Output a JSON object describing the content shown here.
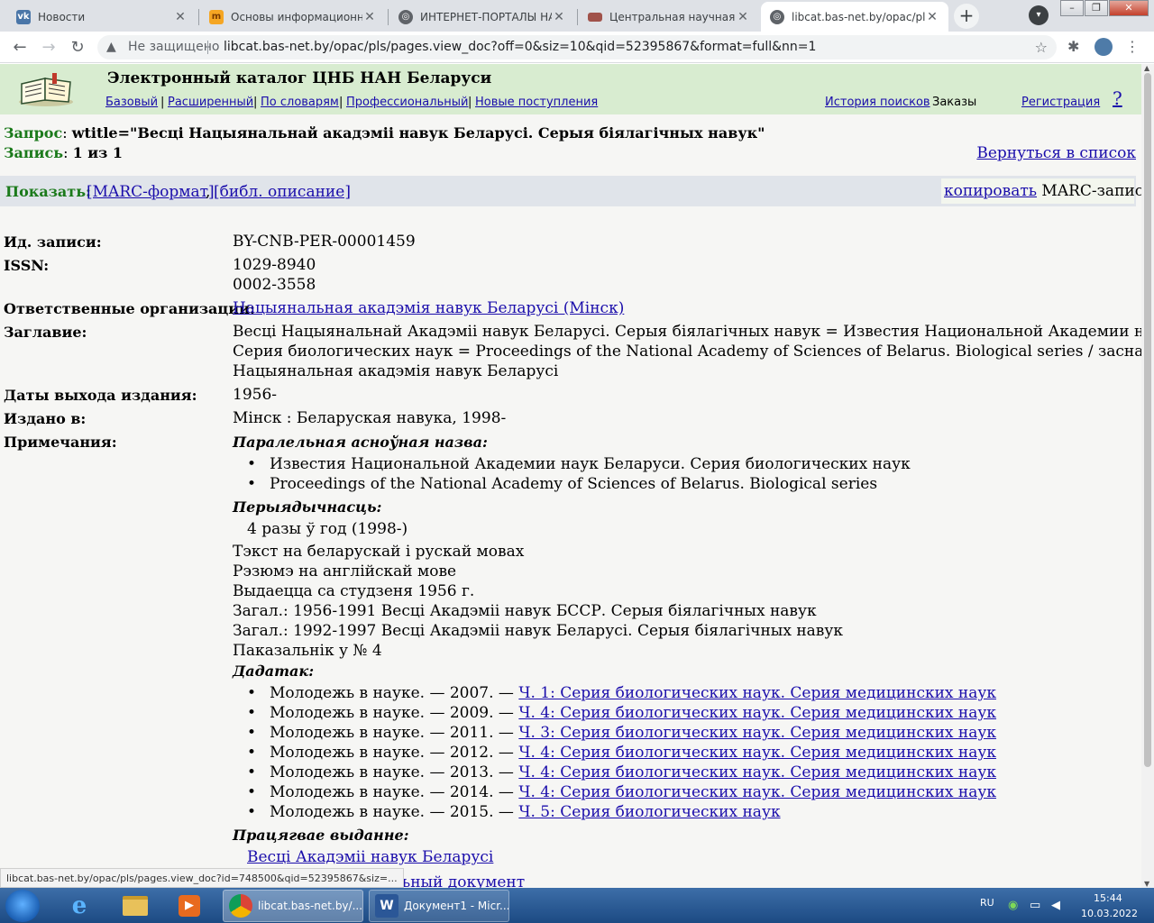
{
  "browser": {
    "tabs": [
      {
        "title": "Новости",
        "icon": "vk-icon"
      },
      {
        "title": "Основы информационной",
        "icon": "tm-icon"
      },
      {
        "title": "ИНТЕРНЕТ-ПОРТАЛЫ НАУ",
        "icon": "globe-icon"
      },
      {
        "title": "Центральная научная биб",
        "icon": "library-icon"
      },
      {
        "title": "libcat.bas-net.by/opac/pls/",
        "icon": "globe-icon"
      }
    ],
    "secure_text": "Не защищено",
    "url": "libcat.bas-net.by/opac/pls/pages.view_doc?off=0&siz=10&qid=52395867&format=full&nn=1",
    "status_url": "libcat.bas-net.by/opac/pls/pages.view_doc?id=748500&qid=52395867&siz=..."
  },
  "site": {
    "title": "Электронный каталог ЦНБ НАН Беларуси",
    "nav": {
      "basic": "Базовый",
      "advanced": "Расширенный",
      "dictionaries": "По словарям",
      "professional": "Профессиональный",
      "new_arrivals": "Новые поступления",
      "history": "История поисков",
      "orders": "Заказы",
      "register": "Регистрация",
      "help": "?"
    }
  },
  "query": {
    "label": "Запрос",
    "text": "wtitle=\"Весці Нацыянальнай акадэміі навук Беларусі. Серыя біялагічных навук\"",
    "record_label": "Запись",
    "record_value": "1 из 1",
    "back_link": "Вернуться в список"
  },
  "show": {
    "label": "Показать:",
    "marc": "[MARC-формат]",
    "comma": ",",
    "bibl": "[библ. описание]",
    "copy_link": "копировать",
    "copy_suffix": "MARC-запись"
  },
  "record": {
    "id_label": "Ид. записи:",
    "id_value": "BY-CNB-PER-00001459",
    "issn_label": "ISSN:",
    "issn_1": "1029-8940",
    "issn_2": "0002-3558",
    "org_label": "Ответственные организации:",
    "org_value": "Нацыянальная акадэмія навук Беларусі (Мінск)",
    "title_label": "Заглавие:",
    "title_line_1": "Весці Нацыянальнай Акадэміі навук Беларусі. Серыя біялагічных навук = Известия Национальной Академии наук Беларуси.",
    "title_line_2": "Серия биологических наук = Proceedings of the National Academy of Sciences of Belarus. Biological series / заснавальнік -",
    "title_line_3": "Нацыянальная акадэмія навук Беларусі",
    "dates_label": "Даты выхода издания:",
    "dates_value": "1956-",
    "published_label": "Издано в:",
    "published_value": "Мінск : Беларуская навука, 1998-",
    "notes_label": "Примечания:"
  },
  "notes": {
    "parallel_title_heading": "Паралельная асноўная назва:",
    "parallel_titles": [
      "Известия Национальной Академии наук Беларуси. Серия биологических наук",
      "Proceedings of the National Academy of Sciences of Belarus. Biological series"
    ],
    "periodicity_heading": "Перыядычнасць:",
    "periodicity_value": "4 разы ў год (1998-)",
    "lines": [
      "Тэкст на беларускай і рускай мовах",
      "Рэзюмэ на англійскай мове",
      "Выдаецца са студзеня 1956 г.",
      "Загал.: 1956-1991 Весці Акадэміі навук БССР. Серыя біялагічных навук",
      "Загал.: 1992-1997 Весці Акадэміі навук Беларусі. Серыя біялагічных навук",
      "Паказальнік у № 4"
    ],
    "supplement_heading": "Дадатак:",
    "supplements": [
      {
        "prefix": "Молодежь в науке. — 2007. — ",
        "link": "Ч. 1: Серия биологических наук. Серия медицинских наук"
      },
      {
        "prefix": "Молодежь в науке. — 2009. — ",
        "link": "Ч. 4: Серия биологических наук. Серия медицинских наук"
      },
      {
        "prefix": "Молодежь в науке. — 2011. — ",
        "link": "Ч. 3: Серия биологических наук. Серия медицинских наук"
      },
      {
        "prefix": "Молодежь в науке. — 2012. — ",
        "link": "Ч. 4: Серия биологических наук. Серия медицинских наук"
      },
      {
        "prefix": "Молодежь в науке. — 2013. — ",
        "link": "Ч. 4: Серия биологических наук. Серия медицинских наук"
      },
      {
        "prefix": "Молодежь в науке. — 2014. — ",
        "link": "Ч. 4: Серия биологических наук. Серия медицинских наук"
      },
      {
        "prefix": "Молодежь в науке. — 2015. — ",
        "link": "Ч. 5: Серия биологических наук"
      }
    ],
    "previous_heading": "Працягвае выданне:",
    "previous_link": "Весці Акадэміі навук Беларусі",
    "cut_off_text": "альный документ"
  },
  "taskbar": {
    "chrome_button": "libcat.bas-net.by/...",
    "word_button": "Документ1 - Micr...",
    "lang": "RU",
    "time": "15:44",
    "date": "10.03.2022"
  }
}
